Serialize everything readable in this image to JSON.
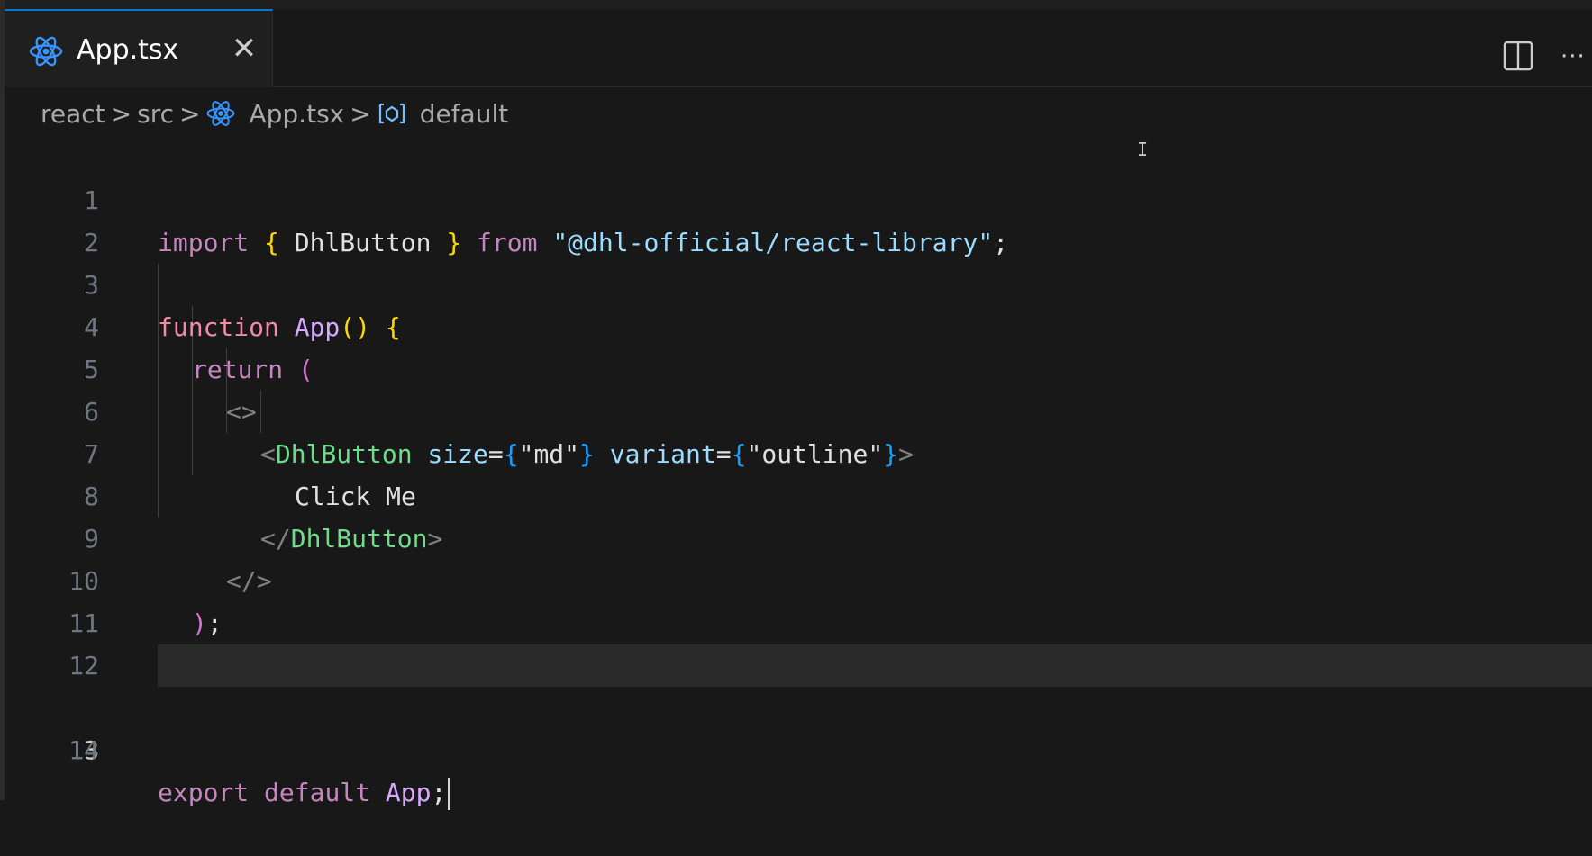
{
  "tab": {
    "label": "App.tsx",
    "close_glyph": "✕"
  },
  "toolbar": {
    "more_glyph": "···"
  },
  "breadcrumb": {
    "items": [
      "react",
      "src",
      "App.tsx",
      "default"
    ],
    "separator": ">"
  },
  "editor": {
    "active_line": 13,
    "lines": [
      {
        "n": "1"
      },
      {
        "n": "2"
      },
      {
        "n": "3"
      },
      {
        "n": "4"
      },
      {
        "n": "5"
      },
      {
        "n": "6"
      },
      {
        "n": "7"
      },
      {
        "n": "8"
      },
      {
        "n": "9"
      },
      {
        "n": "10"
      },
      {
        "n": "11"
      },
      {
        "n": "12"
      },
      {
        "n": "13"
      },
      {
        "n": "14"
      }
    ],
    "tokens": {
      "l1": [
        "import",
        " ",
        "{",
        " DhlButton ",
        "}",
        " ",
        "from",
        " ",
        "\"@dhl-official/react-library\"",
        ";"
      ],
      "l3": [
        "function",
        " ",
        "App",
        "()",
        " ",
        "{"
      ],
      "l4": [
        "return",
        " ",
        "("
      ],
      "l5": [
        "<>"
      ],
      "l6": [
        "<",
        "DhlButton",
        " ",
        "size",
        "=",
        "{",
        "\"md\"",
        "}",
        " ",
        "variant",
        "=",
        "{",
        "\"outline\"",
        "}",
        ">"
      ],
      "l7": [
        "Click Me"
      ],
      "l8": [
        "</",
        "DhlButton",
        ">"
      ],
      "l9": [
        "</>"
      ],
      "l10": [
        ")",
        ";"
      ],
      "l11": [
        "}"
      ],
      "l13": [
        "export",
        " ",
        "default",
        " ",
        "App",
        ";"
      ]
    }
  },
  "icons": [
    "react-icon",
    "close-icon",
    "split-editor-icon",
    "more-actions-icon",
    "symbol-variable-icon"
  ],
  "colors": {
    "background": "#181818",
    "accent": "#0078d4",
    "keyword": "#c586c0",
    "brace": "#ffd700",
    "string": "#9cdcfe",
    "component": "#4ec9b0",
    "react": "#3794ff"
  }
}
